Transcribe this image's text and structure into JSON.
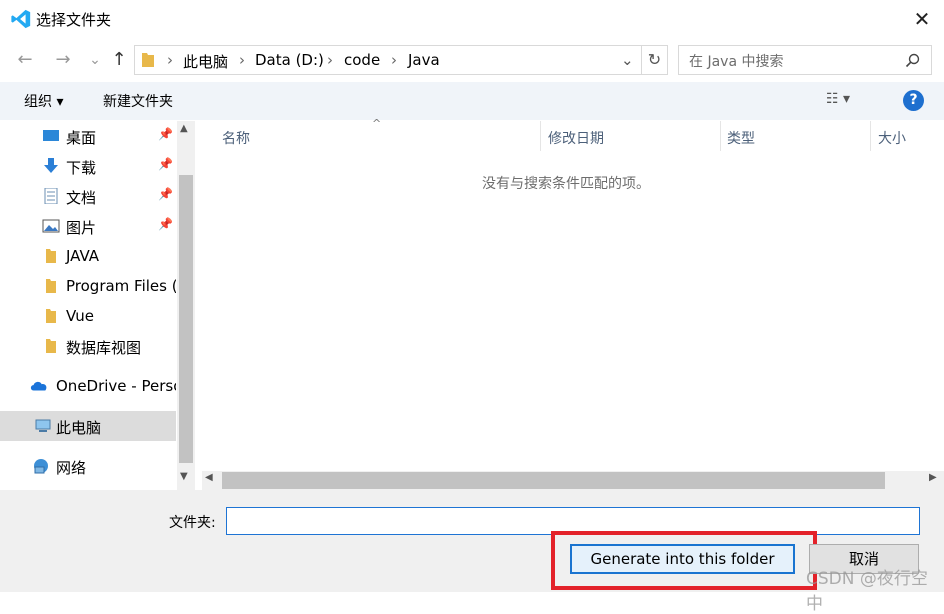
{
  "window": {
    "title": "选择文件夹",
    "close_glyph": "✕"
  },
  "nav": {
    "back": "←",
    "forward": "→",
    "history": "⌄",
    "up": "↑"
  },
  "address": {
    "crumbs": [
      "此电脑",
      "Data (D:)",
      "code",
      "Java"
    ],
    "sep": "›",
    "dropdown": "⌄",
    "refresh": "↻"
  },
  "search": {
    "placeholder": "在 Java 中搜索"
  },
  "toolbar": {
    "organize": "组织 ▾",
    "new_folder": "新建文件夹",
    "view": "☷ ▾",
    "help": "?"
  },
  "sidebar": {
    "items": [
      {
        "label": "桌面",
        "icon": "desktop-icon",
        "pinned": true
      },
      {
        "label": "下载",
        "icon": "download-icon",
        "pinned": true
      },
      {
        "label": "文档",
        "icon": "document-icon",
        "pinned": true
      },
      {
        "label": "图片",
        "icon": "picture-icon",
        "pinned": true
      },
      {
        "label": "JAVA",
        "icon": "folder-icon",
        "pinned": false
      },
      {
        "label": "Program Files (",
        "icon": "folder-icon",
        "pinned": false
      },
      {
        "label": "Vue",
        "icon": "folder-icon",
        "pinned": false
      },
      {
        "label": "数据库视图",
        "icon": "folder-icon",
        "pinned": false
      },
      {
        "label": "OneDrive - Perso",
        "icon": "cloud-icon",
        "pinned": false
      },
      {
        "label": "此电脑",
        "icon": "computer-icon",
        "pinned": false,
        "selected": true
      },
      {
        "label": "网络",
        "icon": "network-icon",
        "pinned": false
      }
    ]
  },
  "columns": [
    "名称",
    "修改日期",
    "类型",
    "大小"
  ],
  "empty_message": "没有与搜索条件匹配的项。",
  "footer": {
    "folder_label": "文件夹:",
    "folder_value": "",
    "primary_button": "Generate into this folder",
    "cancel_button": "取消"
  },
  "watermark": "CSDN @夜行空中",
  "colors": {
    "accent": "#1e74d4",
    "highlight_box": "#e3222a",
    "folder": "#e8b84a",
    "vscode_blue": "#23a9f2"
  }
}
